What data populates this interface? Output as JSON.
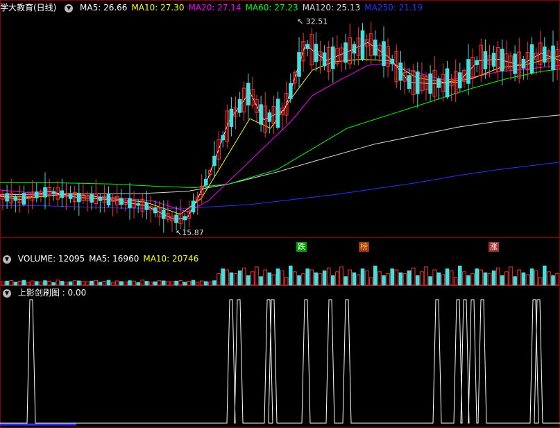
{
  "price_panel": {
    "title": "学大教育(日线)",
    "ma_labels": [
      {
        "text": "MA5: 26.66",
        "color": "#ffffff"
      },
      {
        "text": "MA10: 27.30",
        "color": "#ffff00"
      },
      {
        "text": "MA20: 27.14",
        "color": "#ff00ff"
      },
      {
        "text": "MA60: 27.23",
        "color": "#00ff00"
      },
      {
        "text": "MA120: 25.13",
        "color": "#d9d9d9"
      },
      {
        "text": "MA250: 21.19",
        "color": "#3030ff"
      }
    ],
    "high_label": "32.51",
    "low_label": "15.87",
    "tags": [
      {
        "text": "跌",
        "bg": "#00a000",
        "color": "#ffffff"
      },
      {
        "text": "榜",
        "bg": "#a03030",
        "color": "#ffcc00"
      },
      {
        "text": "涨",
        "bg": "#a03030",
        "color": "#ffffff"
      }
    ]
  },
  "volume_panel": {
    "labels": [
      {
        "text": "VOLUME: 12095",
        "color": "#ffffff"
      },
      {
        "text": "MA5: 16960",
        "color": "#ffffff"
      },
      {
        "text": "MA10: 20746",
        "color": "#ffff00"
      }
    ]
  },
  "indicator_panel": {
    "label": "上影剑刷图 : 0.00"
  },
  "colors": {
    "up": "#ff3030",
    "down": "#40e0e0",
    "border": "#880000"
  },
  "chart_data": [
    {
      "type": "line",
      "series": [
        {
          "name": "MA250",
          "color": "#3030ff",
          "x": [
            0,
            60,
            120,
            180,
            270,
            360,
            420,
            480,
            540,
            600,
            660,
            720,
            807
          ],
          "y": [
            17.6,
            17.6,
            17.5,
            17.4,
            17.4,
            17.7,
            18.1,
            18.5,
            19.0,
            19.5,
            20.1,
            20.6,
            21.2
          ]
        },
        {
          "name": "MA120",
          "color": "#d9d9d9",
          "x": [
            0,
            100,
            200,
            270,
            330,
            400,
            460,
            540,
            600,
            660,
            720,
            807
          ],
          "y": [
            18.5,
            18.6,
            18.6,
            18.8,
            19.4,
            20.4,
            21.4,
            22.7,
            23.4,
            24.1,
            24.6,
            25.1
          ]
        },
        {
          "name": "MA60",
          "color": "#00ff00",
          "x": [
            0,
            80,
            160,
            230,
            280,
            330,
            400,
            450,
            500,
            560,
            620,
            680,
            730,
            780,
            807
          ],
          "y": [
            19.5,
            19.5,
            19.4,
            19.2,
            19.1,
            19.4,
            20.6,
            22.3,
            24.0,
            25.1,
            26.2,
            27.3,
            28.1,
            28.7,
            28.9
          ]
        },
        {
          "name": "MA20",
          "color": "#ff00ff",
          "x": [
            0,
            40,
            90,
            160,
            220,
            270,
            300,
            340,
            380,
            420,
            450,
            490,
            530,
            560,
            600,
            640,
            680,
            720,
            760,
            807
          ],
          "y": [
            18.9,
            18.7,
            18.5,
            18.3,
            18.0,
            17.1,
            18.0,
            20.2,
            22.4,
            24.6,
            26.7,
            28.0,
            29.2,
            29.4,
            28.6,
            28.0,
            28.2,
            28.7,
            28.9,
            29.2
          ]
        },
        {
          "name": "MA10",
          "color": "#ffff00",
          "x": [
            0,
            50,
            100,
            160,
            210,
            260,
            290,
            320,
            360,
            390,
            420,
            450,
            480,
            520,
            560,
            600,
            640,
            680,
            720,
            760,
            807
          ],
          "y": [
            18.4,
            18.3,
            18.6,
            18.2,
            17.9,
            16.9,
            18.2,
            21.0,
            24.8,
            24.0,
            26.5,
            28.8,
            29.5,
            29.7,
            29.6,
            28.2,
            27.8,
            28.1,
            29.0,
            29.3,
            30.0
          ]
        },
        {
          "name": "MA5",
          "color": "#ffffff",
          "x": [
            0,
            30,
            70,
            110,
            160,
            210,
            250,
            270,
            300,
            330,
            360,
            380,
            410,
            440,
            470,
            500,
            530,
            560,
            590,
            620,
            660,
            690,
            720,
            750,
            780,
            807
          ],
          "y": [
            18.4,
            18.1,
            18.8,
            18.3,
            18.1,
            17.6,
            16.5,
            16.6,
            19.9,
            24.6,
            27.0,
            24.7,
            25.5,
            30.9,
            29.6,
            30.3,
            31.1,
            29.9,
            27.8,
            27.7,
            27.8,
            29.6,
            29.7,
            29.2,
            30.2,
            29.6
          ]
        }
      ],
      "high": 32.51,
      "low": 15.87
    },
    {
      "type": "bar",
      "name": "VOLUME",
      "values": [
        12095
      ],
      "ma": {
        "MA5": 16960,
        "MA10": 20746
      }
    },
    {
      "type": "line",
      "name": "上影剑刷图",
      "value": 0.0,
      "spike_x": [
        45,
        333,
        344,
        387,
        393,
        441,
        476,
        500,
        630,
        660,
        670,
        681,
        695,
        770,
        776
      ]
    }
  ]
}
